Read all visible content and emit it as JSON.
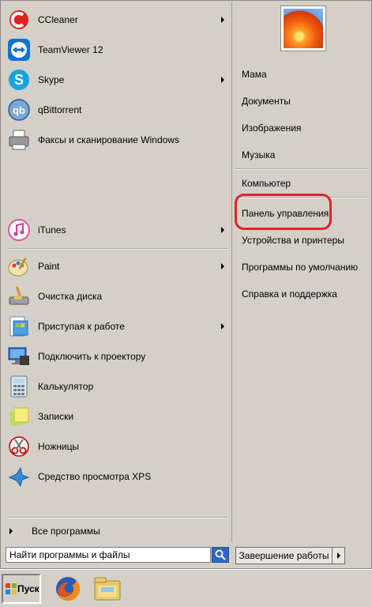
{
  "left_pinned": [
    {
      "label": "CCleaner",
      "icon": "ccleaner-icon",
      "has_submenu": true
    },
    {
      "label": "TeamViewer 12",
      "icon": "teamviewer-icon",
      "has_submenu": false
    },
    {
      "label": "Skype",
      "icon": "skype-icon",
      "has_submenu": true
    },
    {
      "label": "qBittorrent",
      "icon": "qbittorrent-icon",
      "has_submenu": false
    },
    {
      "label": "Факсы и сканирование Windows",
      "icon": "fax-scan-icon",
      "has_submenu": false
    }
  ],
  "left_itunes": {
    "label": "iTunes",
    "icon": "itunes-icon",
    "has_submenu": true
  },
  "left_recent": [
    {
      "label": "Paint",
      "icon": "paint-icon",
      "has_submenu": true
    },
    {
      "label": "Очистка диска",
      "icon": "disk-cleanup-icon",
      "has_submenu": false
    },
    {
      "label": "Приступая к работе",
      "icon": "getting-started-icon",
      "has_submenu": true
    },
    {
      "label": "Подключить к проектору",
      "icon": "projector-icon",
      "has_submenu": false
    },
    {
      "label": "Калькулятор",
      "icon": "calculator-icon",
      "has_submenu": false
    },
    {
      "label": "Записки",
      "icon": "sticky-notes-icon",
      "has_submenu": false
    },
    {
      "label": "Ножницы",
      "icon": "snipping-tool-icon",
      "has_submenu": false
    },
    {
      "label": "Средство просмотра XPS",
      "icon": "xps-viewer-icon",
      "has_submenu": false
    }
  ],
  "all_programs": "Все программы",
  "search_placeholder": "Найти программы и файлы",
  "right_items": {
    "user": "Мама",
    "documents": "Документы",
    "pictures": "Изображения",
    "music": "Музыка",
    "computer": "Компьютер",
    "control_panel": "Панель управления",
    "devices": "Устройства и принтеры",
    "default_programs": "Программы по умолчанию",
    "help": "Справка и поддержка"
  },
  "shutdown_label": "Завершение работы",
  "start_label": "Пуск",
  "colors": {
    "highlight": "#e0222a",
    "menu_bg": "#d4d0c8"
  }
}
